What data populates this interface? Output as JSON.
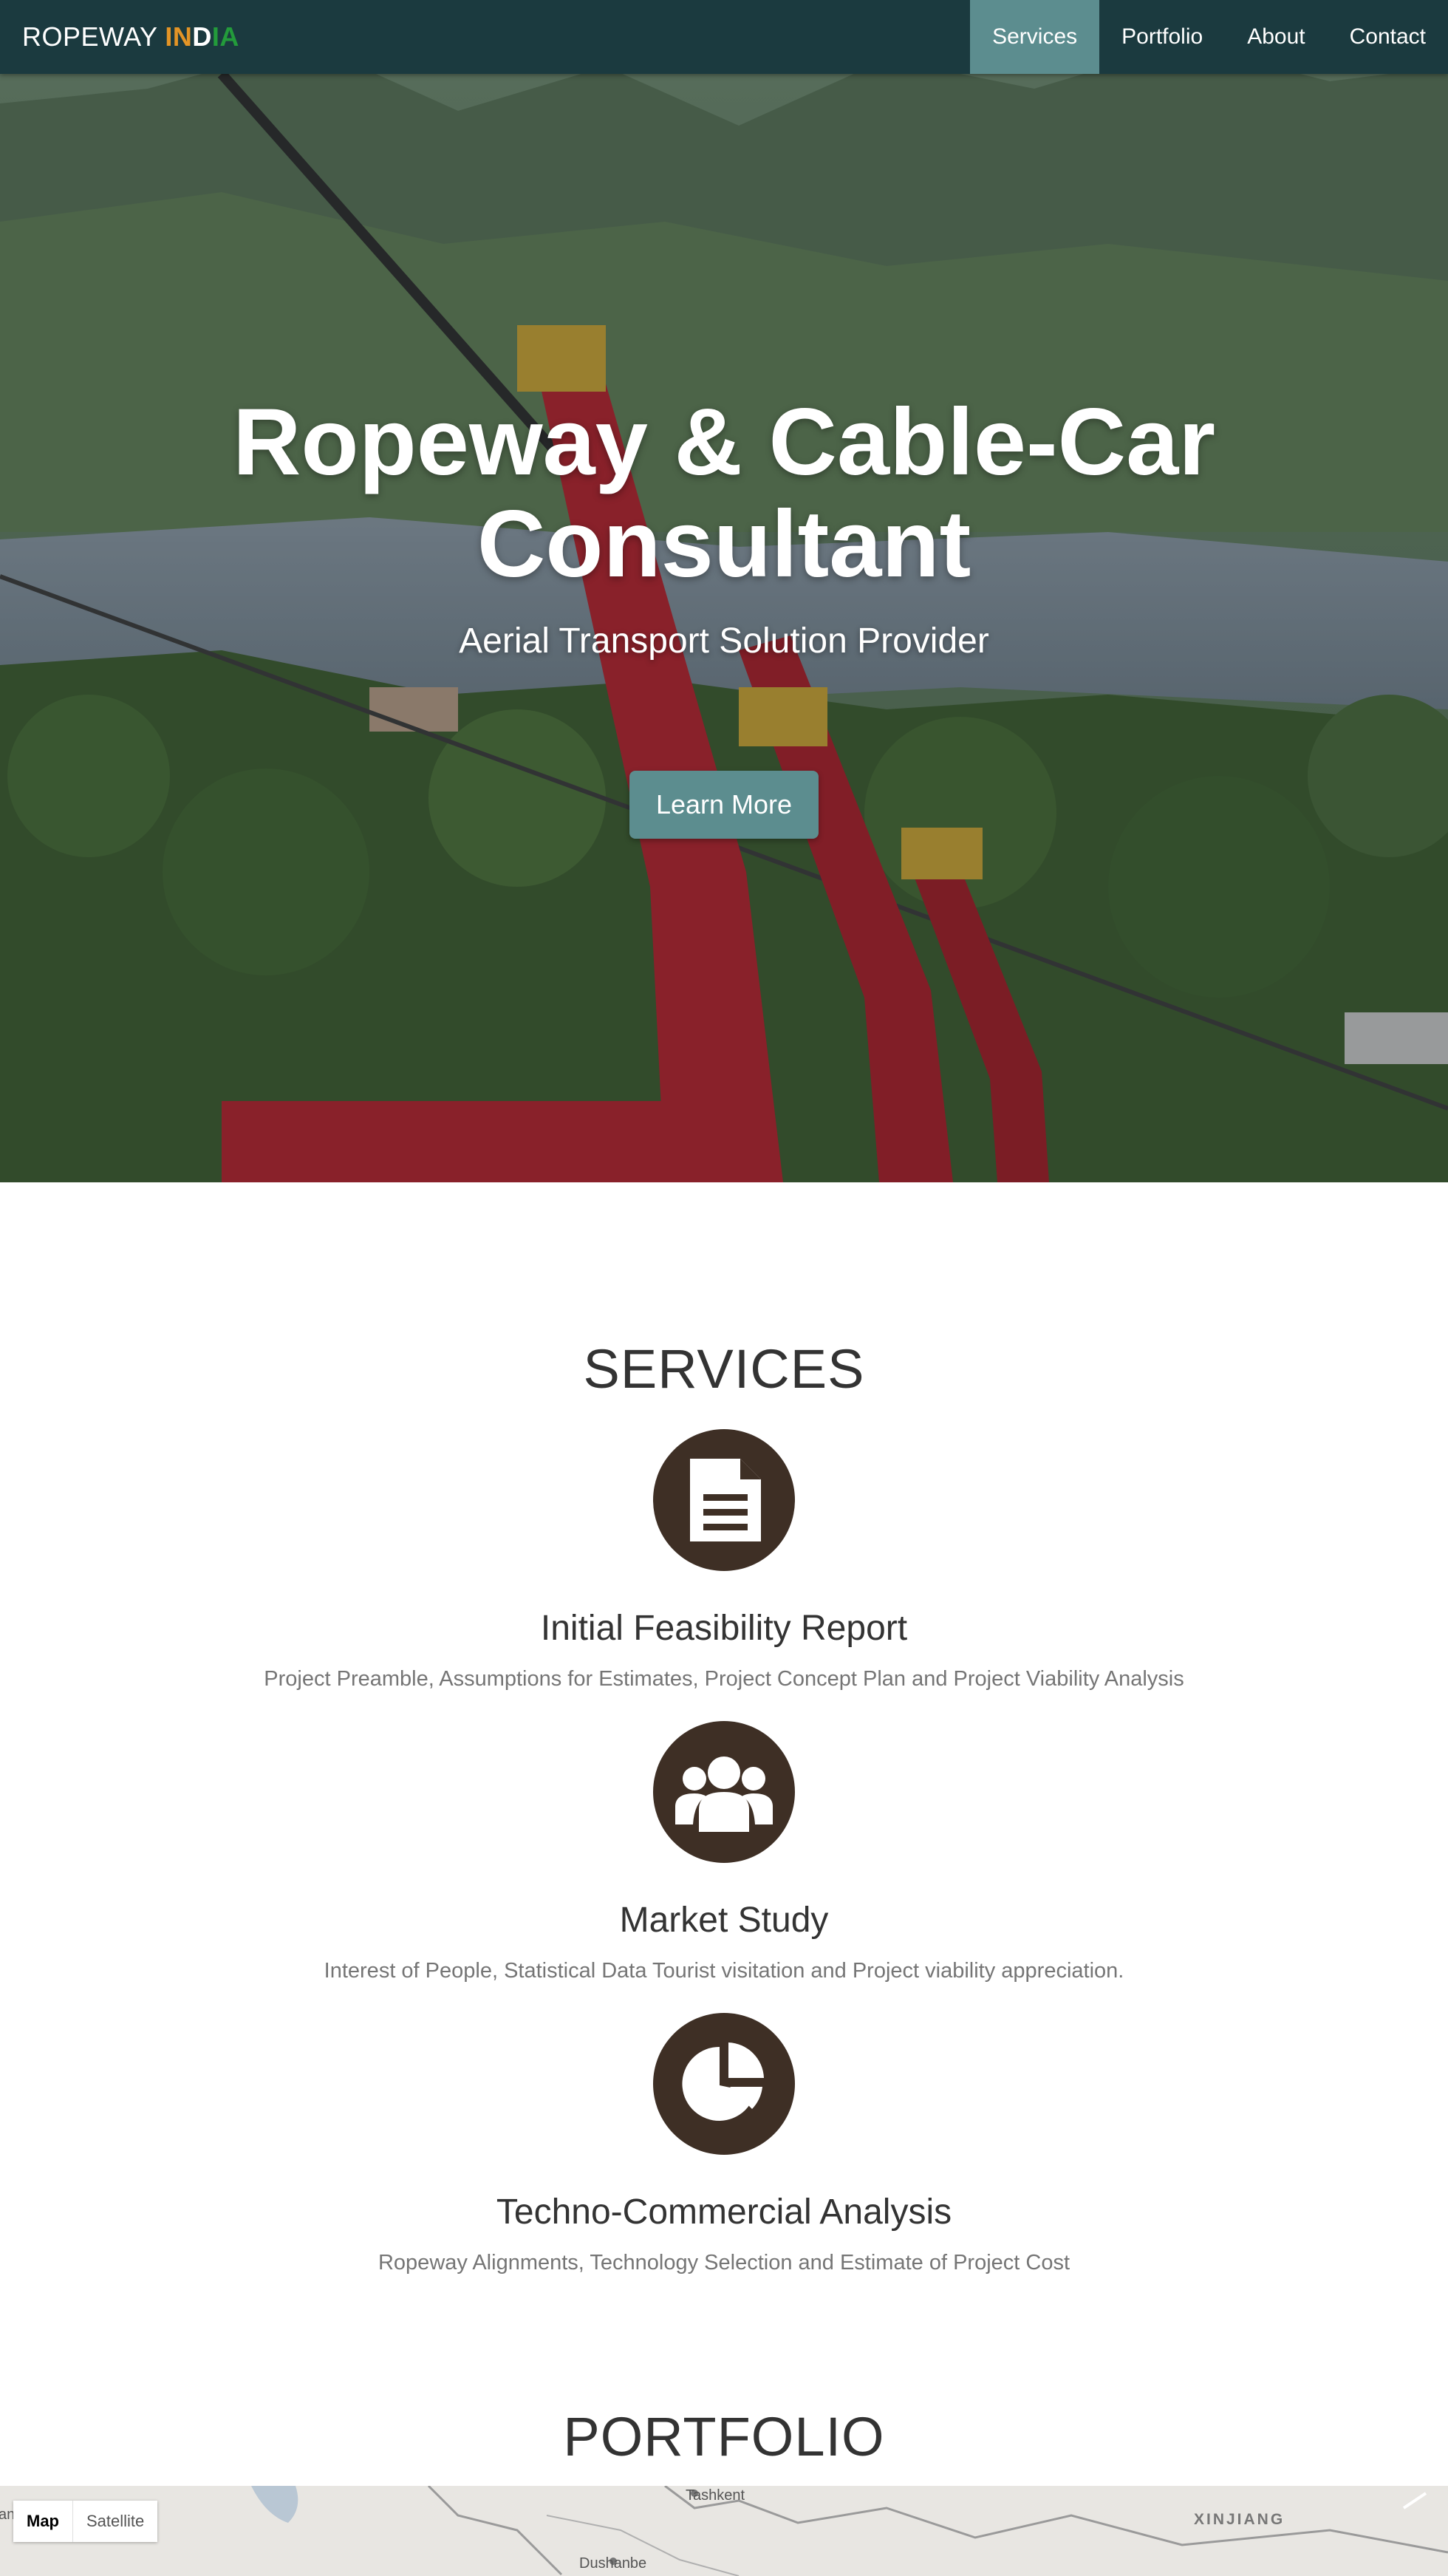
{
  "navbar": {
    "brand_prefix": "ROPEWAY ",
    "brand_parts": [
      "IN",
      "D",
      "IA"
    ],
    "items": [
      {
        "label": "Services",
        "active": true
      },
      {
        "label": "Portfolio",
        "active": false
      },
      {
        "label": "About",
        "active": false
      },
      {
        "label": "Contact",
        "active": false
      }
    ]
  },
  "hero": {
    "title_line1": "Ropeway & Cable-Car",
    "title_line2": "Consultant",
    "subtitle": "Aerial Transport Solution Provider",
    "button_label": "Learn More"
  },
  "services": {
    "heading": "SERVICES",
    "items": [
      {
        "icon": "document-icon",
        "title": "Initial Feasibility Report",
        "description": "Project Preamble, Assumptions for Estimates, Project Concept Plan and Project Viability Analysis"
      },
      {
        "icon": "users-icon",
        "title": "Market Study",
        "description": "Interest of People, Statistical Data Tourist visitation and Project viability appreciation."
      },
      {
        "icon": "pie-chart-icon",
        "title": "Techno-Commercial Analysis",
        "description": "Ropeway Alignments, Technology Selection and Estimate of Project Cost"
      }
    ]
  },
  "portfolio": {
    "heading": "PORTFOLIO"
  },
  "map": {
    "type_buttons": [
      "Map",
      "Satellite"
    ],
    "labels": {
      "edge": "an",
      "city1": "Tashkent",
      "city2": "Dushanbe",
      "region": "XINJIANG"
    }
  },
  "colors": {
    "navbar_bg": "#1b3a3f",
    "accent": "#5c8d8f",
    "icon_circle": "#3e2f25",
    "brand_orange": "#e39426",
    "brand_green": "#239b3b"
  }
}
